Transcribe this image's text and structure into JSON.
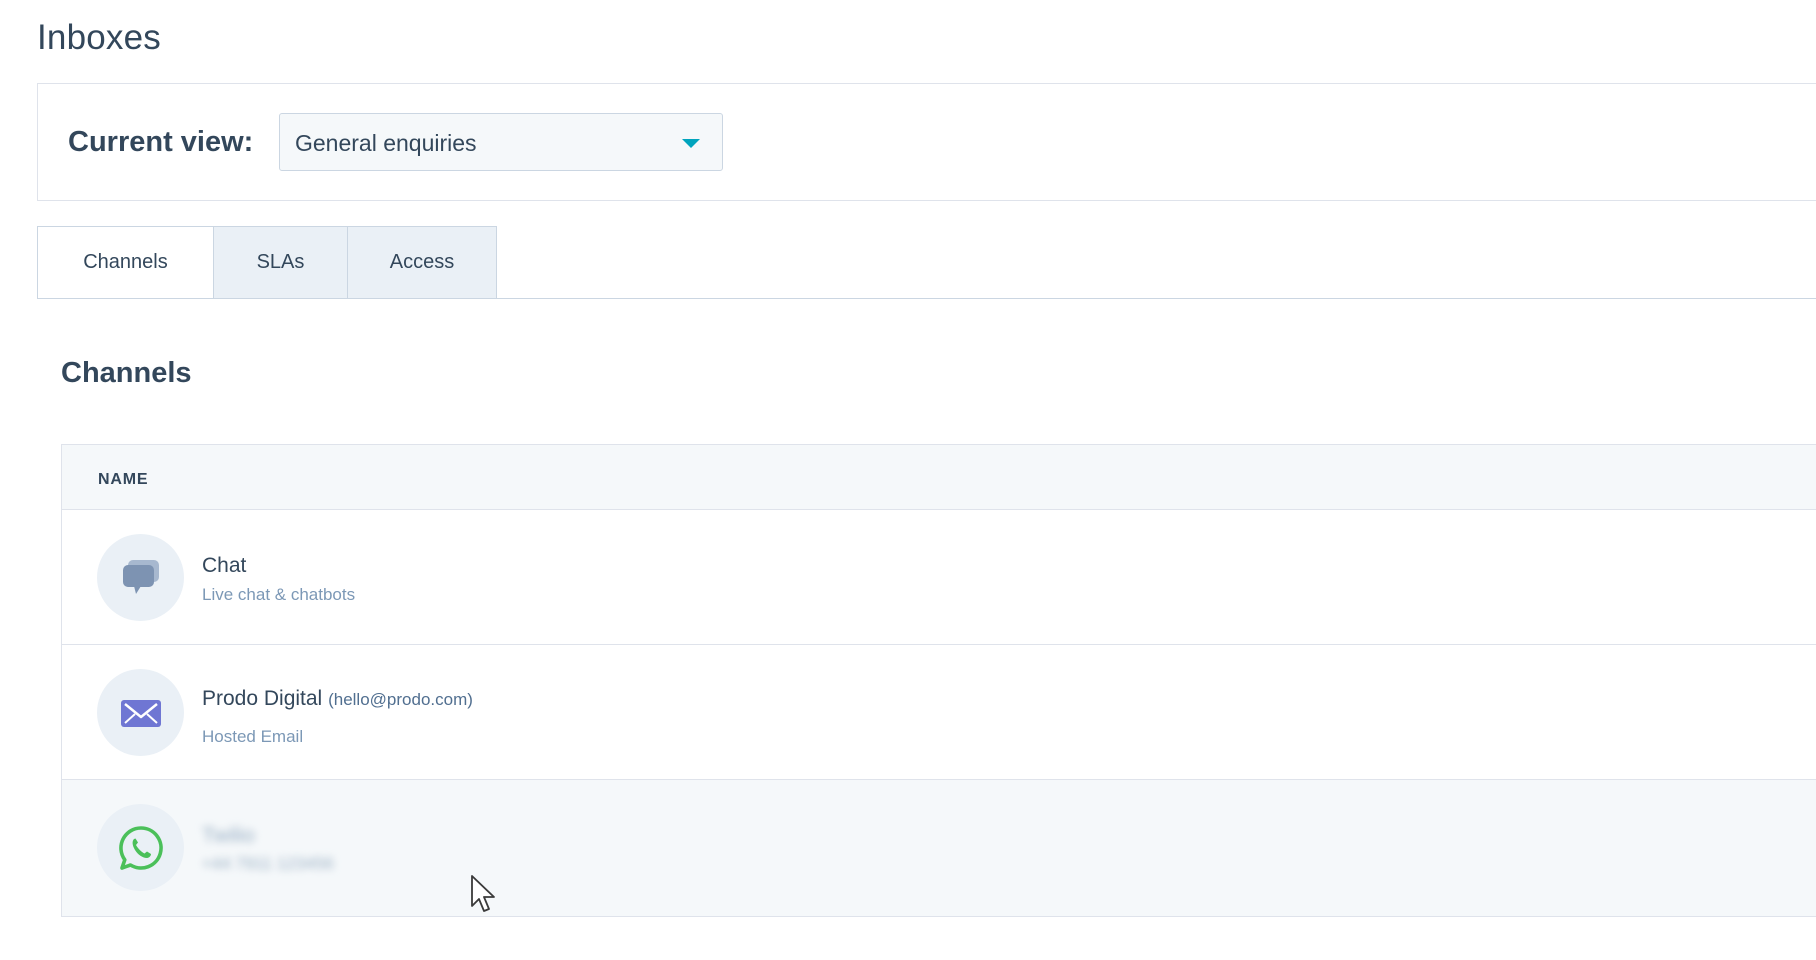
{
  "page": {
    "title": "Inboxes"
  },
  "view": {
    "label": "Current view:",
    "selected": "General enquiries"
  },
  "tabs": [
    {
      "label": "Channels",
      "active": true
    },
    {
      "label": "SLAs",
      "active": false
    },
    {
      "label": "Access",
      "active": false
    }
  ],
  "section": {
    "title": "Channels"
  },
  "table": {
    "column_header": "NAME",
    "rows": [
      {
        "icon": "chat-bubbles-icon",
        "name": "Chat",
        "email": "",
        "subtitle": "Live chat & chatbots"
      },
      {
        "icon": "envelope-icon",
        "name": "Prodo Digital",
        "email": "(hello@prodo.com)",
        "subtitle": "Hosted Email"
      },
      {
        "icon": "whatsapp-icon",
        "name": "Twilio",
        "email": "",
        "subtitle": "+44 7911 123456"
      }
    ]
  },
  "colors": {
    "text_primary": "#33475b",
    "accent_caret": "#00a4bd",
    "whatsapp_green": "#4bc05a",
    "email_icon": "#7a7fd6",
    "chat_icon": "#8da4c2"
  }
}
